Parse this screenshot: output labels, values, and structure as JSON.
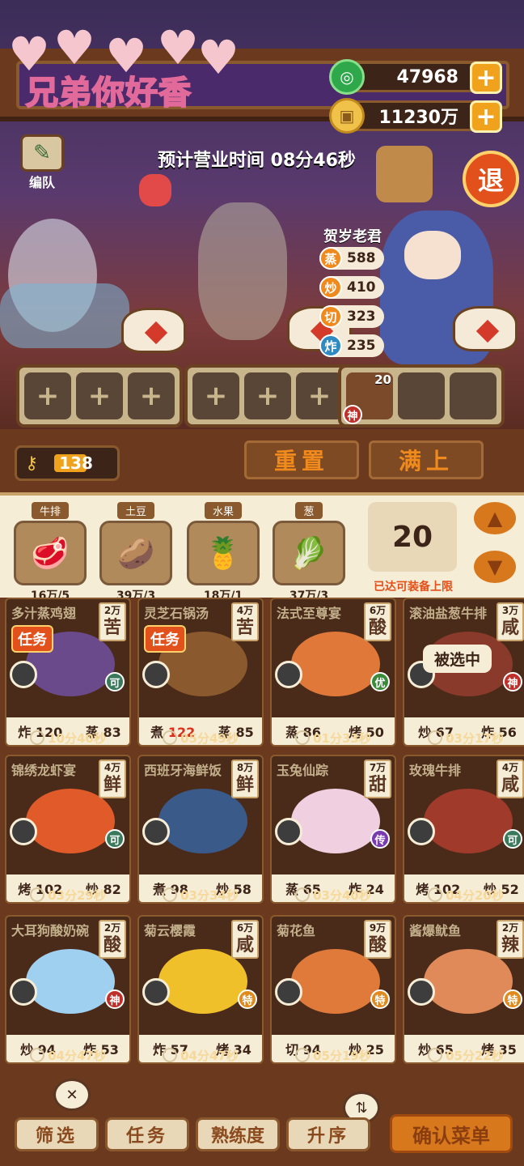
{
  "watermark": {
    "text": "兄弟你好香"
  },
  "currency": {
    "jade": "47968",
    "coins": "11230万",
    "plus": "+"
  },
  "header": {
    "edit_team": "编队",
    "business_time": "预计营业时间   08分46秒",
    "back": "退"
  },
  "chef": {
    "name": "贺岁老君",
    "stats": [
      {
        "icon": "蒸",
        "value": "588"
      },
      {
        "icon": "炒",
        "value": "410"
      },
      {
        "icon": "切",
        "value": "323"
      },
      {
        "icon": "炸",
        "value": "235"
      }
    ]
  },
  "slots": {
    "plus": "+",
    "equipped_level": "20",
    "equipped_rank": "神"
  },
  "controls": {
    "keys": "138",
    "reset": "重置",
    "fill": "满上"
  },
  "ingredients": [
    {
      "tag": "牛排",
      "amount": "16万/5",
      "icon": "🥩"
    },
    {
      "tag": "土豆",
      "amount": "39万/3",
      "icon": "🥔"
    },
    {
      "tag": "水果",
      "amount": "18万/1",
      "icon": "🍍"
    },
    {
      "tag": "葱",
      "amount": "37万/3",
      "icon": "🥬"
    }
  ],
  "equip_count": "20",
  "limit_text": "已达可装备上限",
  "arrows": {
    "up": "▲",
    "down": "▼"
  },
  "selected_label": "被选中",
  "recipes": [
    {
      "name": "多汁蒸鸡翅",
      "price": "2万",
      "taste": "苦",
      "task": "任务",
      "rank": "可",
      "s1": "炸",
      "v1": "120",
      "s2": "蒸",
      "v2": "83",
      "time": "10分40秒"
    },
    {
      "name": "灵芝石锅汤",
      "price": "4万",
      "taste": "苦",
      "task": "任务",
      "rank": "",
      "s1": "煮",
      "v1": "122",
      "s2": "蒸",
      "v2": "85",
      "time": "05分49秒"
    },
    {
      "name": "法式至尊宴",
      "price": "6万",
      "taste": "酸",
      "task": "",
      "rank": "优",
      "s1": "蒸",
      "v1": "86",
      "s2": "烤",
      "v2": "50",
      "time": "01分33秒"
    },
    {
      "name": "滚油盐葱牛排",
      "price": "3万",
      "taste": "咸",
      "task": "",
      "rank": "神",
      "s1": "炒",
      "v1": "67",
      "s2": "炸",
      "v2": "56",
      "time": "03分17秒"
    },
    {
      "name": "锦绣龙虾宴",
      "price": "4万",
      "taste": "鲜",
      "task": "",
      "rank": "可",
      "s1": "烤",
      "v1": "102",
      "s2": "炒",
      "v2": "82",
      "time": "03分29秒"
    },
    {
      "name": "西班牙海鲜饭",
      "price": "8万",
      "taste": "鲜",
      "task": "",
      "rank": "",
      "s1": "煮",
      "v1": "98",
      "s2": "炒",
      "v2": "58",
      "time": "03分34秒"
    },
    {
      "name": "玉兔仙踪",
      "price": "7万",
      "taste": "甜",
      "task": "",
      "rank": "传",
      "s1": "蒸",
      "v1": "65",
      "s2": "炸",
      "v2": "24",
      "time": "03分40秒"
    },
    {
      "name": "玫瑰牛排",
      "price": "4万",
      "taste": "咸",
      "task": "",
      "rank": "可",
      "s1": "烤",
      "v1": "102",
      "s2": "炒",
      "v2": "52",
      "time": "04分20秒"
    },
    {
      "name": "大耳狗酸奶碗",
      "price": "2万",
      "taste": "酸",
      "task": "",
      "rank": "神",
      "s1": "炒",
      "v1": "94",
      "s2": "炸",
      "v2": "53",
      "time": "04分47秒"
    },
    {
      "name": "菊云樱霞",
      "price": "6万",
      "taste": "咸",
      "task": "",
      "rank": "特",
      "s1": "炸",
      "v1": "57",
      "s2": "烤",
      "v2": "34",
      "time": "04分47秒"
    },
    {
      "name": "菊花鱼",
      "price": "9万",
      "taste": "酸",
      "task": "",
      "rank": "特",
      "s1": "切",
      "v1": "94",
      "s2": "炒",
      "v2": "25",
      "time": "05分19秒"
    },
    {
      "name": "酱爆鱿鱼",
      "price": "2万",
      "taste": "辣",
      "task": "",
      "rank": "特",
      "s1": "炒",
      "v1": "65",
      "s2": "烤",
      "v2": "35",
      "time": "05分22秒"
    }
  ],
  "footer": {
    "filter": "筛选",
    "task": "任务",
    "proficiency": "熟练度",
    "sort": "升序",
    "confirm": "确认菜单"
  },
  "colors": {
    "accent": "#f08a1c",
    "wood": "#6b3a1e",
    "cream": "#f6edd6",
    "alert": "#e2501c"
  }
}
